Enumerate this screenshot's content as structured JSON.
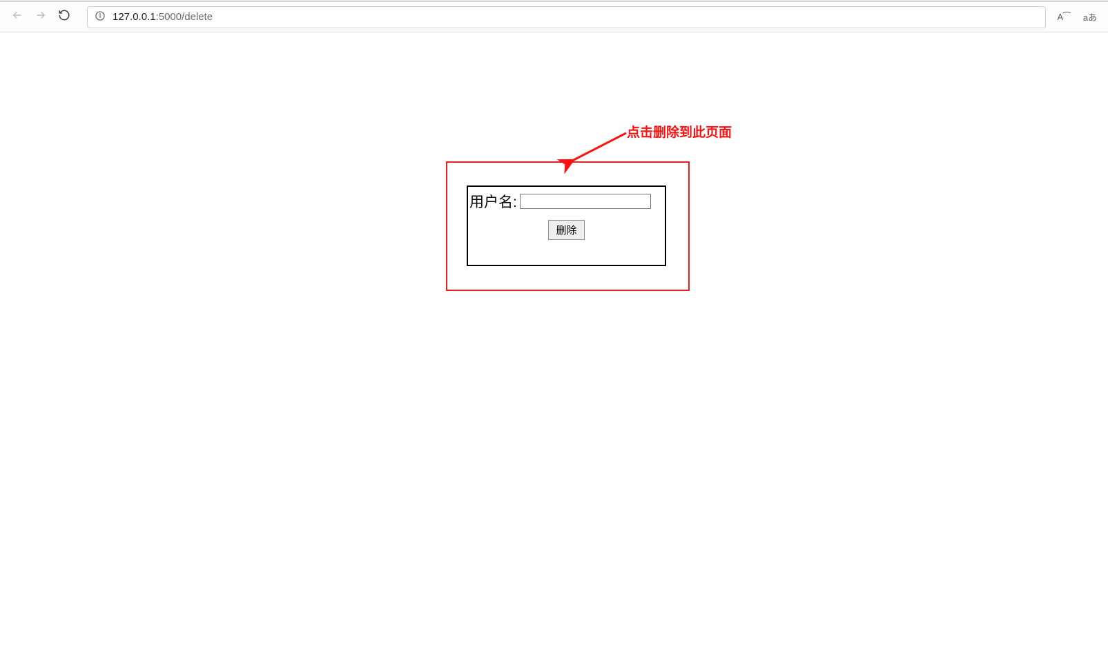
{
  "url": {
    "host": "127.0.0.1",
    "port_path": ":5000/delete"
  },
  "form": {
    "username_label": "用户名:",
    "username_value": "",
    "delete_button": "删除"
  },
  "annotation": {
    "label": "点击删除到此页面"
  },
  "toolbar_icons": {
    "read_aloud": "A⁀",
    "translate": "aあ"
  }
}
